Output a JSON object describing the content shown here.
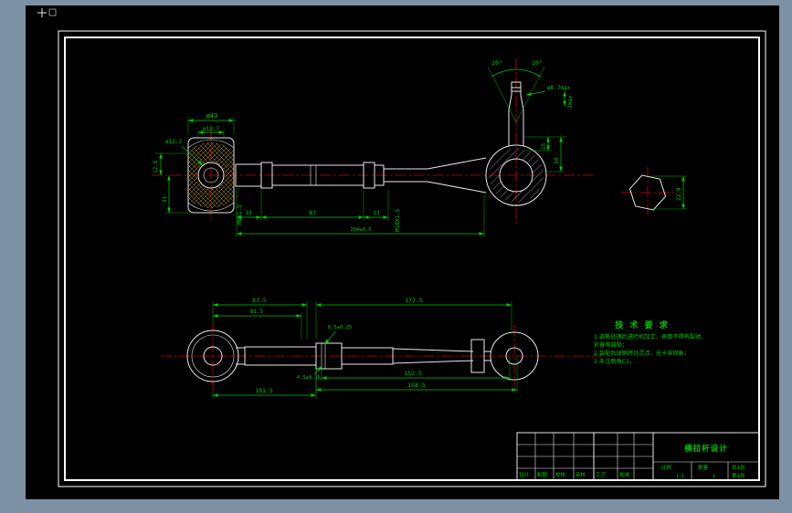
{
  "app": {
    "background": "#7e92a6",
    "canvas": "#000000",
    "line_color": "#e8e8e8",
    "dimension_color": "#00c800",
    "centerline_color": "#d40000",
    "hatch_yellow": "#b8982f"
  },
  "top_view": {
    "dims": {
      "d43": "ø43",
      "d19_7": "ø19.7",
      "d12_2": "ø12.2",
      "v1": "12.5",
      "v2": "31",
      "m8": "M8X1.5",
      "len13l": "13",
      "len83": "83",
      "len13r": "13",
      "m10": "M10X1.5",
      "total": "204±0.5",
      "ang_l": "20°",
      "ang_r": "20°",
      "d8_7max": "ø8.7max",
      "max2": "2max",
      "v15": "15",
      "v38": "38"
    }
  },
  "hex_detail": {
    "dim": "22.9"
  },
  "bottom_view": {
    "dims": {
      "top1": "83.5",
      "top2": "81.5",
      "top3": "172.5",
      "s1": "8.5±0.25",
      "s2": "4.5±0.15",
      "b1": "152.5",
      "b2": "158.5",
      "b3": "101.5"
    }
  },
  "notes": {
    "title": "技 术 要 求",
    "lines": [
      "1.调质处理后进行机加工，表面不得有裂纹、",
      "  折叠等缺陷；",
      "2.装配后球销转动灵活，无卡滞现象；",
      "3.未注倒角C1。"
    ]
  },
  "title_block": {
    "name": "横拉杆设计",
    "design": "设计",
    "draft": "制图",
    "check": "校核",
    "audit": "审核",
    "process": "工艺",
    "approve": "批准",
    "scale_label": "比例",
    "scale": "1:1",
    "qty_label": "数量",
    "qty": "1",
    "sheet_total": "共1张",
    "sheet_no": "第1张"
  }
}
